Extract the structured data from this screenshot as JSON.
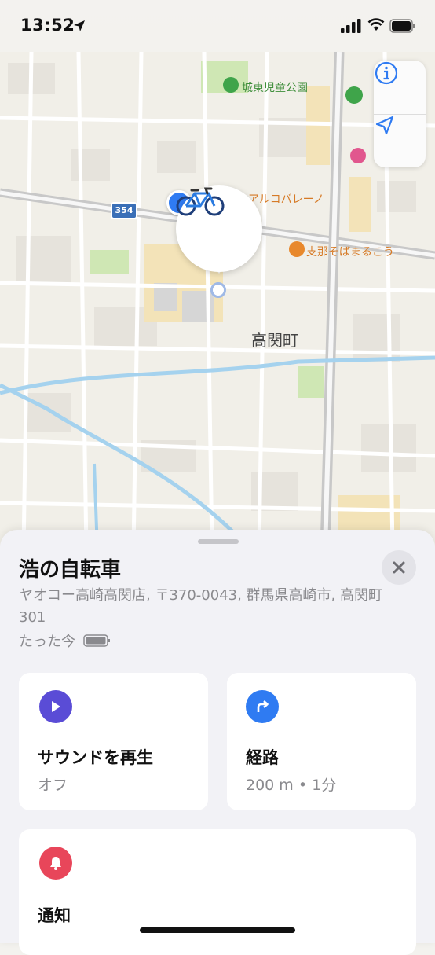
{
  "status_bar": {
    "time": "13:52"
  },
  "map": {
    "labels": {
      "park": "城東児童公園",
      "arco": "アルコバレーノ",
      "soba": "支那そばまるこう",
      "town": "高関町",
      "route": "354"
    },
    "colors": {
      "user_dot": "#2f7bf2",
      "park_poi": "#3fa44a",
      "food_poi": "#e8882c"
    }
  },
  "sheet": {
    "title": "浩の自転車",
    "address": "ヤオコー高崎高関店, 〒370-0043, 群馬県高崎市, 高関町301",
    "updated": "たった今",
    "cards": {
      "sound": {
        "title": "サウンドを再生",
        "subtitle": "オフ",
        "icon": "play-icon",
        "color": "#5a4cd6"
      },
      "route": {
        "title": "経路",
        "subtitle": "200 m • 1分",
        "icon": "turn-right-icon",
        "color": "#2f7bf2"
      },
      "notify": {
        "title": "通知",
        "icon": "bell-icon",
        "color": "#e8465a"
      }
    }
  }
}
